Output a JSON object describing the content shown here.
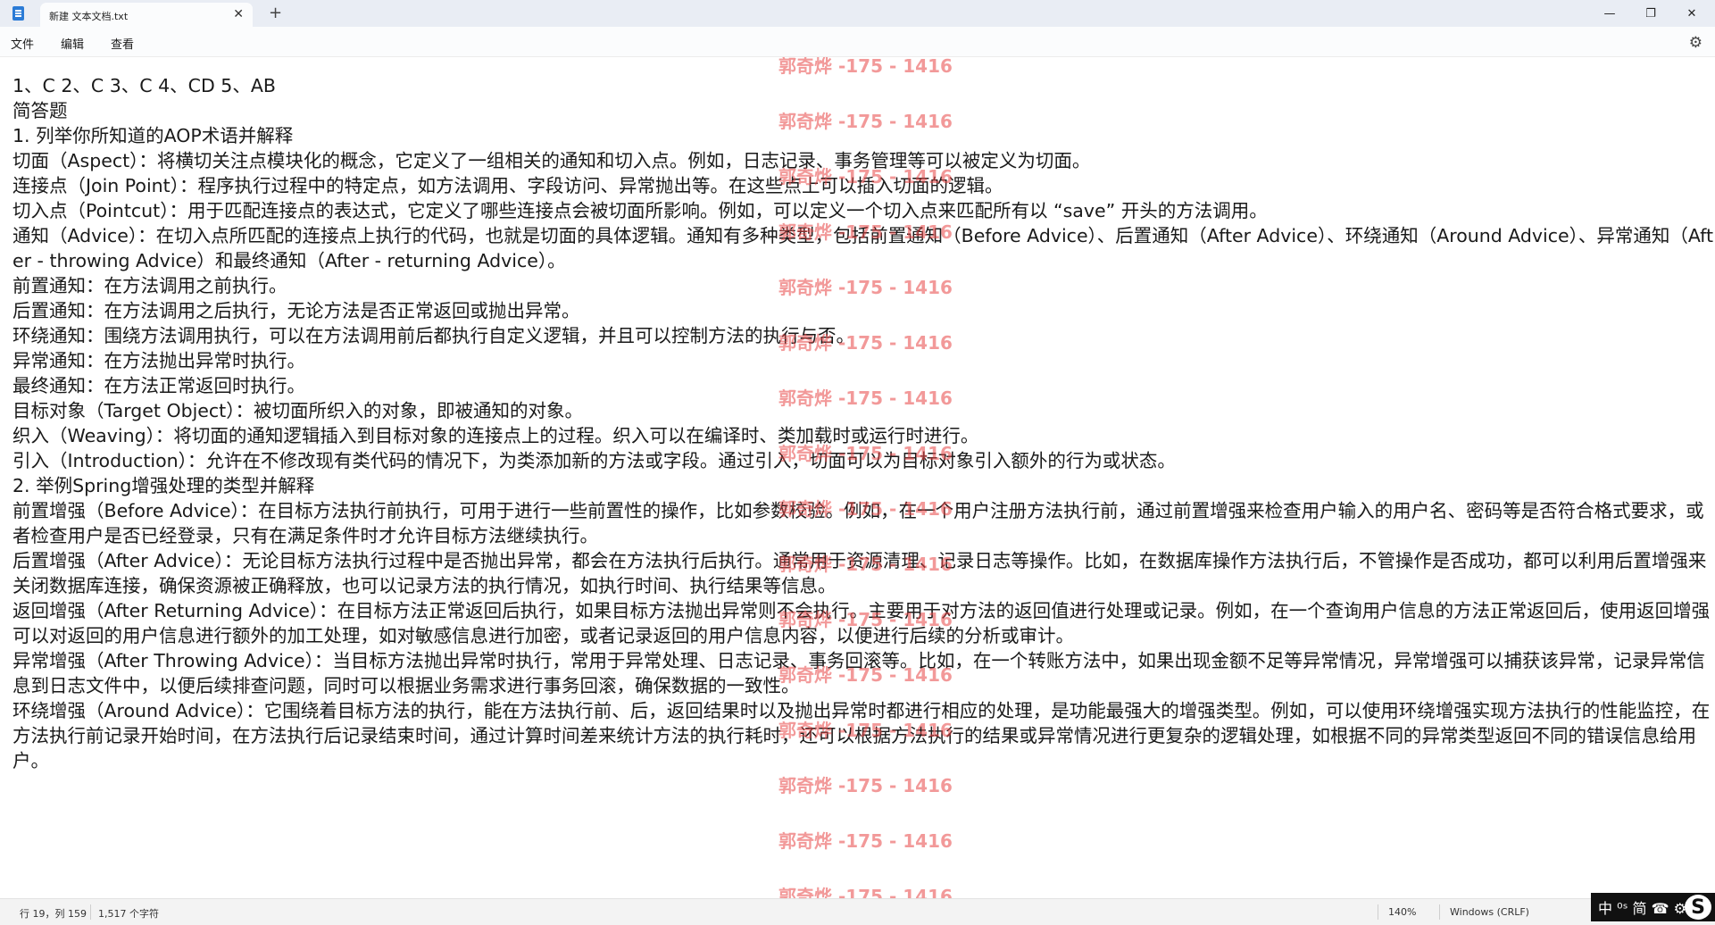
{
  "window": {
    "tab_title": "新建 文本文档.txt",
    "tab_close": "✕",
    "new_tab": "+",
    "minimize": "—",
    "maximize": "❐",
    "close": "✕"
  },
  "menu": {
    "items": [
      "文件",
      "编辑",
      "查看"
    ],
    "settings_icon": "⚙"
  },
  "document": {
    "lines": [
      "1、C 2、C 3、C 4、CD 5、AB",
      "简答题",
      "1. 列举你所知道的AOP术语并解释",
      "切面（Aspect）：将横切关注点模块化的概念，它定义了一组相关的通知和切入点。例如，日志记录、事务管理等可以被定义为切面。",
      "连接点（Join Point）：程序执行过程中的特定点，如方法调用、字段访问、异常抛出等。在这些点上可以插入切面的逻辑。",
      "切入点（Pointcut）：用于匹配连接点的表达式，它定义了哪些连接点会被切面所影响。例如，可以定义一个切入点来匹配所有以 “save” 开头的方法调用。",
      "通知（Advice）：在切入点所匹配的连接点上执行的代码，也就是切面的具体逻辑。通知有多种类型，包括前置通知（Before Advice）、后置通知（After Advice）、环绕通知（Around Advice）、异常通知（After - throwing Advice）和最终通知（After - returning Advice）。",
      "前置通知：在方法调用之前执行。",
      "后置通知：在方法调用之后执行，无论方法是否正常返回或抛出异常。",
      "环绕通知：围绕方法调用执行，可以在方法调用前后都执行自定义逻辑，并且可以控制方法的执行与否。",
      "异常通知：在方法抛出异常时执行。",
      "最终通知：在方法正常返回时执行。",
      "目标对象（Target Object）：被切面所织入的对象，即被通知的对象。",
      "织入（Weaving）：将切面的通知逻辑插入到目标对象的连接点上的过程。织入可以在编译时、类加载时或运行时进行。",
      "引入（Introduction）：允许在不修改现有类代码的情况下，为类添加新的方法或字段。通过引入，切面可以为目标对象引入额外的行为或状态。",
      "2. 举例Spring增强处理的类型并解释",
      "前置增强（Before Advice）：在目标方法执行前执行，可用于进行一些前置性的操作，比如参数校验。例如，在一个用户注册方法执行前，通过前置增强来检查用户输入的用户名、密码等是否符合格式要求，或者检查用户是否已经登录，只有在满足条件时才允许目标方法继续执行。",
      "后置增强（After Advice）：无论目标方法执行过程中是否抛出异常，都会在方法执行后执行。通常用于资源清理、记录日志等操作。比如，在数据库操作方法执行后，不管操作是否成功，都可以利用后置增强来关闭数据库连接，确保资源被正确释放，也可以记录方法的执行情况，如执行时间、执行结果等信息。",
      "返回增强（After Returning Advice）：在目标方法正常返回后执行，如果目标方法抛出异常则不会执行。主要用于对方法的返回值进行处理或记录。例如，在一个查询用户信息的方法正常返回后，使用返回增强可以对返回的用户信息进行额外的加工处理，如对敏感信息进行加密，或者记录返回的用户信息内容，以便进行后续的分析或审计。",
      "异常增强（After Throwing Advice）：当目标方法抛出异常时执行，常用于异常处理、日志记录、事务回滚等。比如，在一个转账方法中，如果出现金额不足等异常情况，异常增强可以捕获该异常，记录异常信息到日志文件中，以便后续排查问题，同时可以根据业务需求进行事务回滚，确保数据的一致性。",
      "环绕增强（Around Advice）：它围绕着目标方法的执行，能在方法执行前、后，返回结果时以及抛出异常时都进行相应的处理，是功能最强大的增强类型。例如，可以使用环绕增强实现方法执行的性能监控，在方法执行前记录开始时间，在方法执行后记录结束时间，通过计算时间差来统计方法的执行耗时，还可以根据方法执行的结果或异常情况进行更复杂的逻辑处理，如根据不同的异常类型返回不同的错误信息给用户。"
    ]
  },
  "watermark": {
    "text": "郭奇烨 -175 - 1416"
  },
  "status": {
    "position": "行 19，列 159",
    "char_count": "1,517 个字符",
    "zoom": "140%",
    "line_ending": "Windows (CRLF)"
  },
  "ime": {
    "label": "中 ⁰ˢ 简 ☎ ⚙",
    "logo": "S"
  }
}
